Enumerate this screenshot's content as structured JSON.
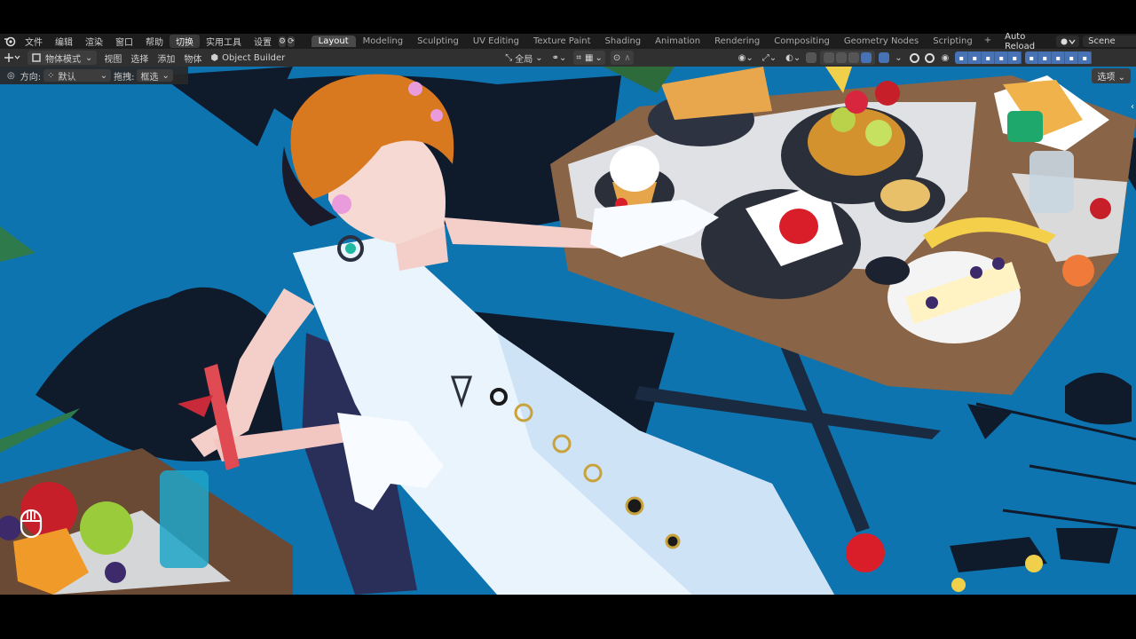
{
  "topbar": {
    "menus": [
      "文件",
      "编辑",
      "渲染",
      "窗口",
      "帮助"
    ],
    "switch_label": "切换",
    "tools_label": "实用工具",
    "settings_label": "设置",
    "workspaces": [
      "Layout",
      "Modeling",
      "Sculpting",
      "UV Editing",
      "Texture Paint",
      "Shading",
      "Animation",
      "Rendering",
      "Compositing",
      "Geometry Nodes",
      "Scripting"
    ],
    "active_workspace": "Layout",
    "add_workspace": "+",
    "auto_reload": "Auto Reload",
    "scene": "Scene"
  },
  "header": {
    "mode": "物体模式",
    "view": "视图",
    "select": "选择",
    "add": "添加",
    "object": "物体",
    "addon": "Object Builder",
    "transform_orientation": "全局"
  },
  "tool_settings": {
    "orientation_label": "方向:",
    "orientation_value": "默认",
    "drag_label": "拖拽:",
    "drag_value": "框选",
    "options": "选项"
  },
  "colors": {
    "viewport_bg": "#0e74b0",
    "accent": "#4772b3",
    "topbar": "#1d1d1d",
    "header": "#303030"
  }
}
